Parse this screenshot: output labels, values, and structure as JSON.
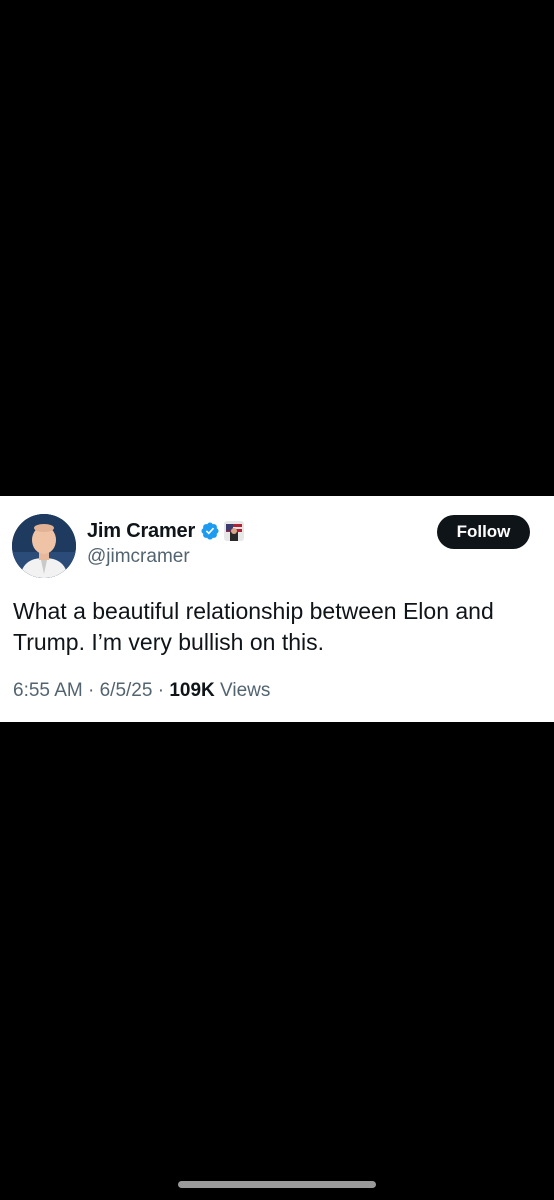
{
  "tweet": {
    "display_name": "Jim Cramer",
    "handle": "@jimcramer",
    "follow_label": "Follow",
    "text": "What a beautiful relationship between Elon and Trump. I’m very bullish on this.",
    "time": "6:55 AM",
    "separator": " · ",
    "date": "6/5/25",
    "views_count": "109K",
    "views_label": " Views",
    "icons": {
      "verified": "verified-badge-icon",
      "affiliate": "affiliate-badge-icon"
    },
    "colors": {
      "verified_blue": "#1d9bf0",
      "text_primary": "#0f1419",
      "text_secondary": "#536471",
      "follow_bg": "#0f1419"
    }
  }
}
